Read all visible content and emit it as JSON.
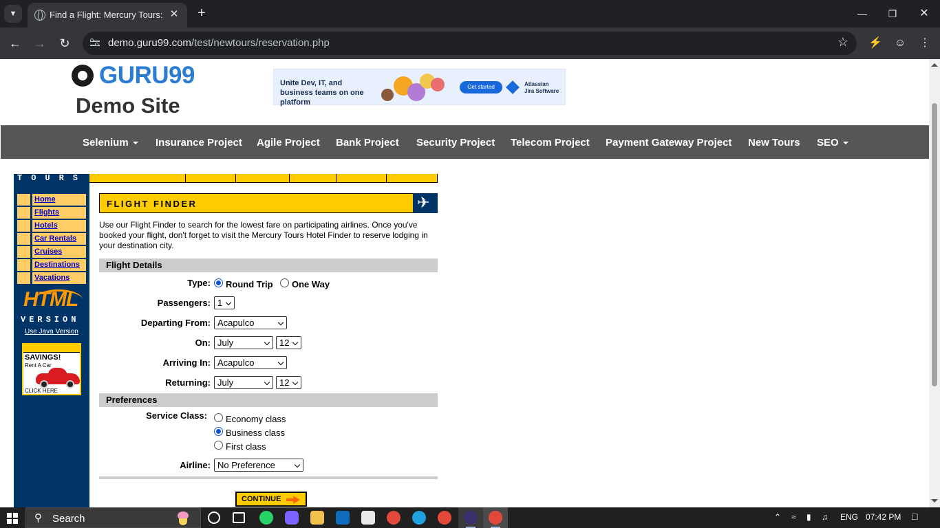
{
  "browser": {
    "tab_title": "Find a Flight: Mercury Tours:",
    "url_host": "demo.guru99.com",
    "url_path": "/test/newtours/reservation.php"
  },
  "site": {
    "logo_top": "GURU99",
    "logo_bottom": "Demo Site",
    "ad_text": "Unite Dev, IT, and business teams on one platform",
    "ad_button": "Get started",
    "ad_brand_1": "Atlassian",
    "ad_brand_2": "Jira Software"
  },
  "nav": [
    {
      "label": "Selenium",
      "dropdown": true
    },
    {
      "label": "Insurance Project"
    },
    {
      "label": "Agile Project"
    },
    {
      "label": "Bank Project"
    },
    {
      "label": "Security Project"
    },
    {
      "label": "Telecom Project"
    },
    {
      "label": "Payment Gateway Project"
    },
    {
      "label": "New Tours"
    },
    {
      "label": "SEO",
      "dropdown": true
    }
  ],
  "sidebar": {
    "tours_text": "TOURS",
    "menu": [
      "Home",
      "Flights",
      "Hotels",
      "Car Rentals",
      "Cruises",
      "Destinations",
      "Vacations"
    ],
    "html_word": "HTML",
    "version_word": "VERSION",
    "java_link": "Use Java Version",
    "savings_title": "SAVINGS!",
    "savings_sub": "Rent A Car",
    "savings_click": "CLICK HERE"
  },
  "finder": {
    "title": "FLIGHT FINDER",
    "intro": "Use our Flight Finder to search for the lowest fare on participating airlines. Once you've booked your flight, don't forget to visit the Mercury Tours Hotel Finder to reserve lodging in your destination city.",
    "flight_details": "Flight Details",
    "type_label": "Type:",
    "type_round": "Round Trip",
    "type_oneway": "One Way",
    "passengers_label": "Passengers:",
    "passengers_value": "1",
    "departing_label": "Departing From:",
    "departing_value": "Acapulco",
    "on_label": "On:",
    "on_month": "July",
    "on_day": "12",
    "arriving_label": "Arriving In:",
    "arriving_value": "Acapulco",
    "returning_label": "Returning:",
    "returning_month": "July",
    "returning_day": "12",
    "preferences": "Preferences",
    "service_label": "Service Class:",
    "class_economy": "Economy class",
    "class_business": "Business class",
    "class_first": "First class",
    "airline_label": "Airline:",
    "airline_value": "No Preference",
    "continue_label": "CONTINUE"
  },
  "taskbar": {
    "search_text": "Search",
    "lang": "ENG",
    "time": "07:42 PM"
  },
  "colors": {
    "mercury_blue": "#003366",
    "mercury_yellow": "#ffcc00",
    "nav_gray": "#565656",
    "guru_blue": "#2b7cd3"
  }
}
